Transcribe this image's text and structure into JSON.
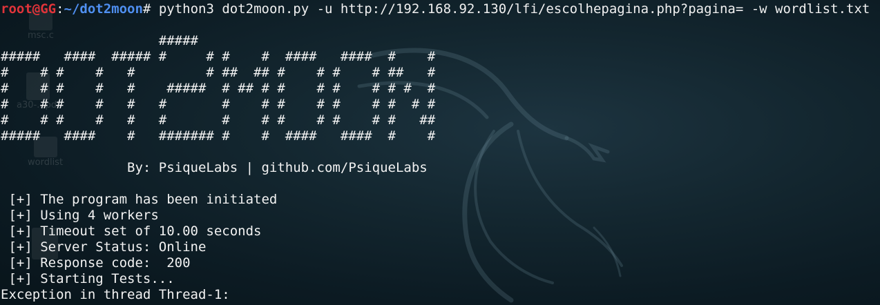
{
  "window": {
    "type": "terminal"
  },
  "desktop_icons": [
    {
      "name": "msc-file-icon",
      "label": "msc.c"
    },
    {
      "name": "pdf-file-icon",
      "label": "a30-...pdf"
    },
    {
      "name": "text-file-icon",
      "label": "wordlist"
    }
  ],
  "prompt": {
    "user_host": "root@GG",
    "separator": ":",
    "path": "~/dot2moon",
    "symbol": "#",
    "command": " python3 dot2moon.py -u http://192.168.92.130/lfi/escolhepagina.php?pagina= -w wordlist.txt"
  },
  "banner": [
    "                    #####",
    "#####   ####  ##### #     # #    #  ####   ####  #    #",
    "#    # #    #   #         # ##  ## #    # #    # ##   #",
    "#    # #    #   #    #####  # ## # #    # #    # # #  #",
    "#    # #    #   #   #       #    # #    # #    # #  # #",
    "#    # #    #   #   #       #    # #    # #    # #   ##",
    "#####   ####    #   ####### #    #  ####   ####  #    #"
  ],
  "credit": "                By: PsiqueLabs | github.com/PsiqueLabs",
  "output": [
    " [+] The program has been initiated",
    " [+] Using 4 workers",
    " [+] Timeout set of 10.00 seconds",
    " [+] Server Status: Online",
    " [+] Response code:  200",
    " [+] Starting Tests...",
    "Exception in thread Thread-1:"
  ],
  "colors": {
    "background": "#0b1a22",
    "user_host": "#e0343a",
    "path": "#4f8ff0",
    "text": "#f2f2f2"
  }
}
